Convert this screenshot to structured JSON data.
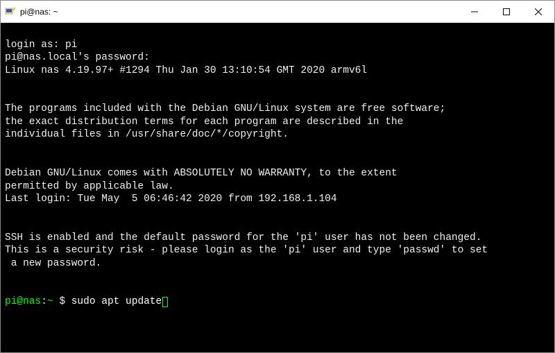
{
  "window": {
    "title": "pi@nas: ~"
  },
  "terminal": {
    "login_prompt": "login as: pi",
    "password_prompt": "pi@nas.local's password:",
    "kernel_line": "Linux nas 4.19.97+ #1294 Thu Jan 30 13:10:54 GMT 2020 armv6l",
    "motd_para1_l1": "The programs included with the Debian GNU/Linux system are free software;",
    "motd_para1_l2": "the exact distribution terms for each program are described in the",
    "motd_para1_l3": "individual files in /usr/share/doc/*/copyright.",
    "motd_para2_l1": "Debian GNU/Linux comes with ABSOLUTELY NO WARRANTY, to the extent",
    "motd_para2_l2": "permitted by applicable law.",
    "last_login": "Last login: Tue May  5 06:46:42 2020 from 192.168.1.104",
    "ssh_warn_l1": "SSH is enabled and the default password for the 'pi' user has not been changed.",
    "ssh_warn_l2": "This is a security risk - please login as the 'pi' user and type 'passwd' to set",
    "ssh_warn_l3": " a new password.",
    "prompt_user_host": "pi@nas",
    "prompt_sep": ":",
    "prompt_path": "~",
    "prompt_symbol": " $ ",
    "command": "sudo apt update"
  }
}
